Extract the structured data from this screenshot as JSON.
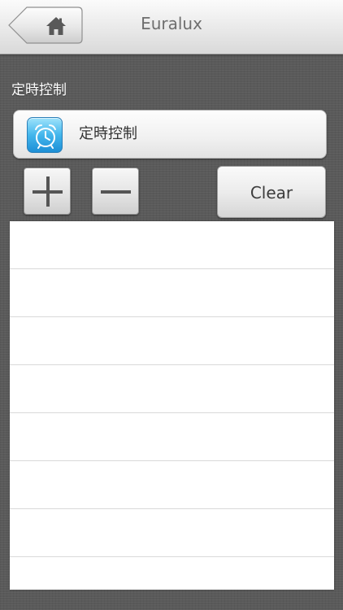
{
  "header": {
    "title": "Euralux",
    "home_icon": "home-icon"
  },
  "section": {
    "label": "定時控制"
  },
  "timer_selector": {
    "icon": "alarm-clock-icon",
    "label": "定時控制"
  },
  "controls": {
    "add_icon": "plus-icon",
    "remove_icon": "minus-icon",
    "clear_label": "Clear"
  },
  "timer_list": {
    "rows": [
      "",
      "",
      "",
      "",
      "",
      "",
      "",
      ""
    ]
  },
  "colors": {
    "background": "#5a5a5a",
    "header": "#ececec",
    "icon_blue": "#43b6ec",
    "text_dark": "#333333",
    "text_light": "#ffffff"
  }
}
